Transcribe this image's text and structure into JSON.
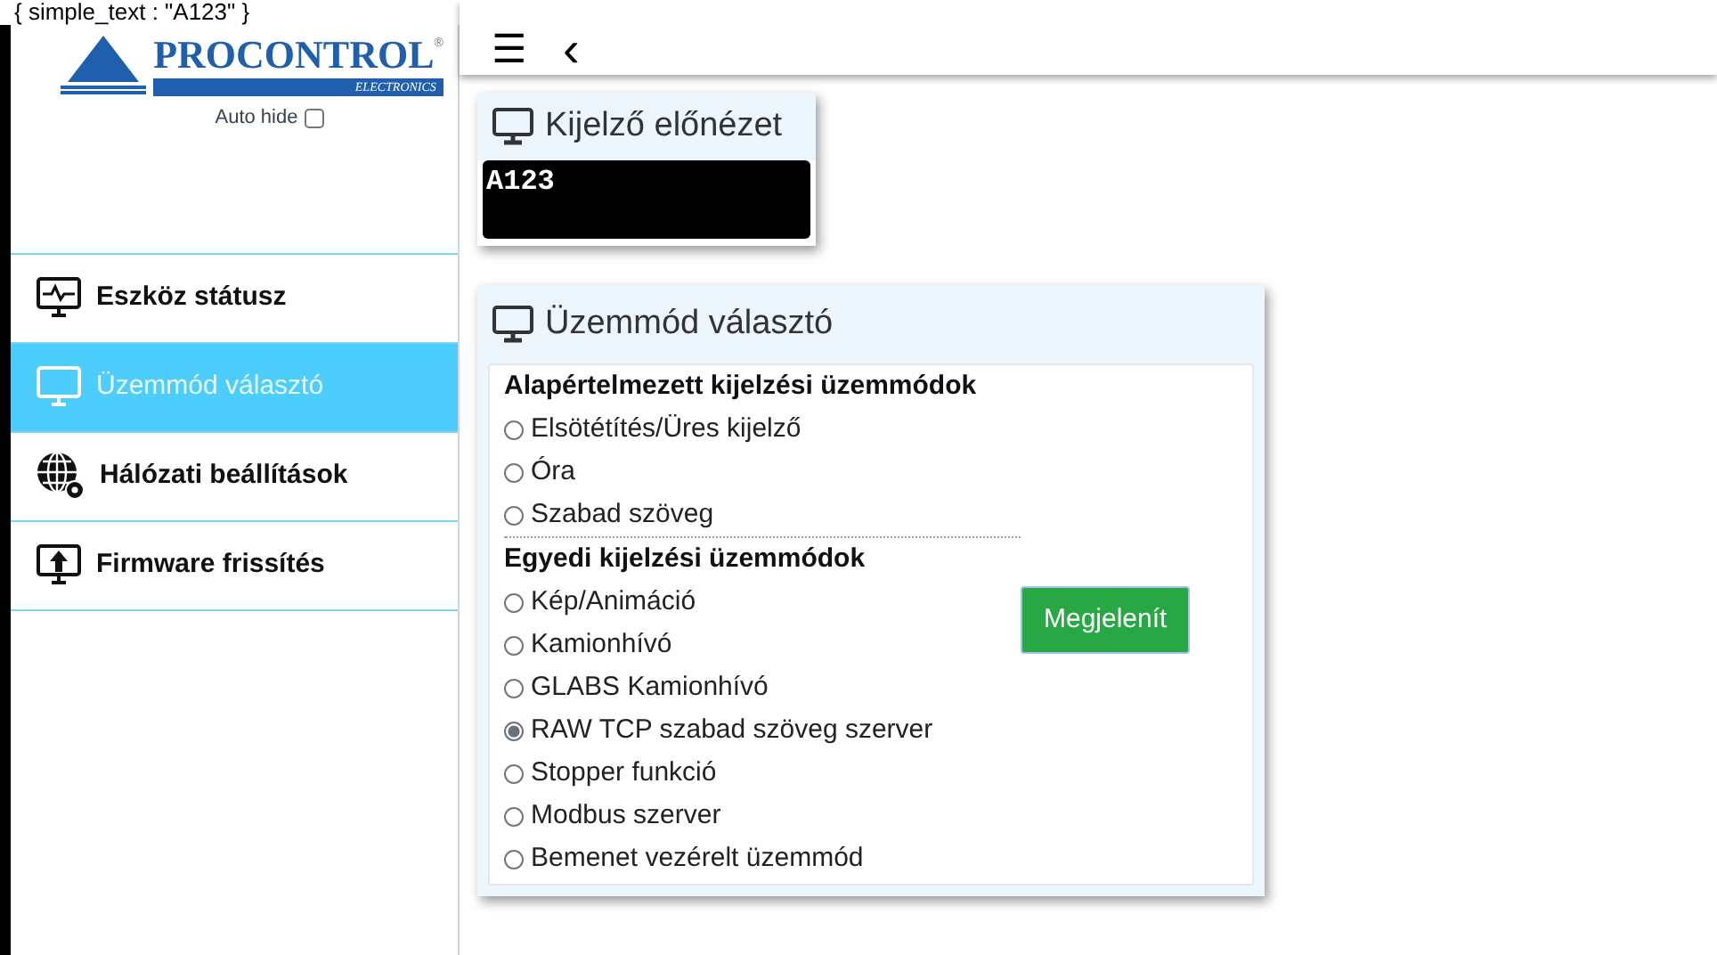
{
  "top_text": "{ simple_text : \"A123\" }",
  "logo": {
    "name": "PROCONTROL",
    "sub": "ELECTRONICS",
    "mark": "®"
  },
  "auto_hide": {
    "label": "Auto hide",
    "checked": false
  },
  "sidebar": {
    "items": [
      {
        "label": "Eszköz státusz",
        "kind": "status",
        "selected": false
      },
      {
        "label": "Üzemmód választó",
        "kind": "monitor",
        "selected": true
      },
      {
        "label": "Hálózati beállítások",
        "kind": "network",
        "selected": false
      },
      {
        "label": "Firmware frissítés",
        "kind": "upload",
        "selected": false
      }
    ]
  },
  "toolbar": {
    "menu": "☰",
    "back": "‹"
  },
  "preview": {
    "title": "Kijelző előnézet",
    "display_text": "A123"
  },
  "mode_panel": {
    "title": "Üzemmód választó",
    "groups": [
      {
        "heading": "Alapértelmezett kijelzési üzemmódok",
        "options": [
          {
            "label": "Elsötétítés/Üres kijelző",
            "selected": false
          },
          {
            "label": "Óra",
            "selected": false
          },
          {
            "label": "Szabad szöveg",
            "selected": false
          }
        ]
      },
      {
        "heading": "Egyedi kijelzési üzemmódok",
        "options": [
          {
            "label": "Kép/Animáció",
            "selected": false
          },
          {
            "label": "Kamionhívó",
            "selected": false
          },
          {
            "label": "GLABS Kamionhívó",
            "selected": false
          },
          {
            "label": "RAW TCP szabad szöveg szerver",
            "selected": true
          },
          {
            "label": "Stopper funkció",
            "selected": false
          },
          {
            "label": "Modbus szerver",
            "selected": false
          },
          {
            "label": "Bemenet vezérelt üzemmód",
            "selected": false
          }
        ]
      }
    ],
    "button": "Megjelenít"
  }
}
